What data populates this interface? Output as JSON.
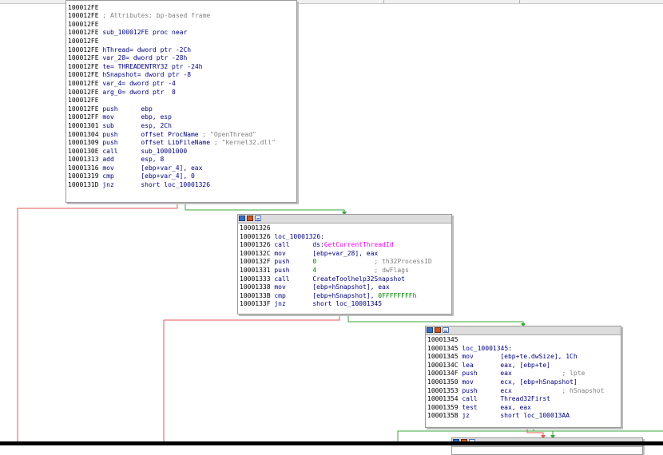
{
  "edge_colors": {
    "false_branch": "#e05a5a",
    "true_branch": "#3aa53a"
  },
  "nodes": [
    {
      "id": "node-10001326-prologue",
      "lines": [
        {
          "addr": "100012FE",
          "text": "",
          "kind": "plain"
        },
        {
          "addr": "100012FE",
          "text": "",
          "kind": "plain"
        },
        {
          "addr": "100012FE",
          "text": " ; Attributes: bp-based frame",
          "kind": "comment"
        },
        {
          "addr": "100012FE",
          "text": "",
          "kind": "plain"
        },
        {
          "addr": "100012FE",
          "text": " sub_100012FE proc near",
          "kind": "label"
        },
        {
          "addr": "100012FE",
          "text": "",
          "kind": "plain"
        },
        {
          "addr": "100012FE",
          "text": " hThread= dword ptr -2Ch",
          "kind": "label"
        },
        {
          "addr": "100012FE",
          "text": " var_28= dword ptr -28h",
          "kind": "label"
        },
        {
          "addr": "100012FE",
          "text": " te= THREADENTRY32 ptr -24h",
          "kind": "label"
        },
        {
          "addr": "100012FE",
          "text": " hSnapshot= dword ptr -8",
          "kind": "label"
        },
        {
          "addr": "100012FE",
          "text": " var_4= dword ptr -4",
          "kind": "label"
        },
        {
          "addr": "100012FE",
          "text": " arg_0= dword ptr  8",
          "kind": "label"
        },
        {
          "addr": "100012FE",
          "text": "",
          "kind": "plain"
        },
        {
          "addr": "100012FE",
          "mnemonic": "push",
          "operand": "ebp",
          "kind": "instr"
        },
        {
          "addr": "100012FF",
          "mnemonic": "mov",
          "operand": "ebp, esp",
          "kind": "instr"
        },
        {
          "addr": "10001301",
          "mnemonic": "sub",
          "operand": "esp, 2Ch",
          "kind": "instr"
        },
        {
          "addr": "10001304",
          "mnemonic": "push",
          "operand": "offset ProcName",
          "comment": " ; \"OpenThread\"",
          "kind": "instr"
        },
        {
          "addr": "10001309",
          "mnemonic": "push",
          "operand": "offset LibFileName",
          "comment": " ; \"kernel32.dll\"",
          "kind": "instr"
        },
        {
          "addr": "1000130E",
          "mnemonic": "call",
          "operand": "sub_10001000",
          "kind": "instr"
        },
        {
          "addr": "10001313",
          "mnemonic": "add",
          "operand": "esp, 8",
          "kind": "instr"
        },
        {
          "addr": "10001316",
          "mnemonic": "mov",
          "operand": "[ebp+var_4], eax",
          "kind": "instr"
        },
        {
          "addr": "10001319",
          "mnemonic": "cmp",
          "operand": "[ebp+var_4], 0",
          "kind": "instr"
        },
        {
          "addr": "1000131D",
          "mnemonic": "jnz",
          "operand": "short loc_10001326",
          "kind": "instr"
        }
      ]
    },
    {
      "id": "node-10001326",
      "lines": [
        {
          "addr": "10001326",
          "text": "",
          "kind": "plain"
        },
        {
          "addr": "10001326",
          "text": " loc_10001326:",
          "kind": "label"
        },
        {
          "addr": "10001326",
          "mnemonic": "call",
          "operand_pre": "ds:",
          "operand_fn": "GetCurrentThreadId",
          "kind": "instr"
        },
        {
          "addr": "1000132C",
          "mnemonic": "mov",
          "operand": "[ebp+var_28], eax",
          "kind": "instr"
        },
        {
          "addr": "1000132F",
          "mnemonic": "push",
          "operand_num": "0",
          "comment": "               ; th32ProcessID",
          "kind": "instr"
        },
        {
          "addr": "10001331",
          "mnemonic": "push",
          "operand_num": "4",
          "comment": "               ; dwFlags",
          "kind": "instr"
        },
        {
          "addr": "10001333",
          "mnemonic": "call",
          "operand": "CreateToolhelp32Snapshot",
          "kind": "instr"
        },
        {
          "addr": "10001338",
          "mnemonic": "mov",
          "operand": "[ebp+hSnapshot], eax",
          "kind": "instr"
        },
        {
          "addr": "1000133B",
          "mnemonic": "cmp",
          "operand": "[ebp+hSnapshot], ",
          "operand_num2": "0FFFFFFFFh",
          "kind": "instr"
        },
        {
          "addr": "1000133F",
          "mnemonic": "jnz",
          "operand": "short loc_10001345",
          "kind": "instr"
        }
      ]
    },
    {
      "id": "node-10001345",
      "lines": [
        {
          "addr": "10001345",
          "text": "",
          "kind": "plain"
        },
        {
          "addr": "10001345",
          "text": " loc_10001345:",
          "kind": "label"
        },
        {
          "addr": "10001345",
          "mnemonic": "mov",
          "operand": "[ebp+te.dwSize], 1Ch",
          "kind": "instr"
        },
        {
          "addr": "1000134C",
          "mnemonic": "lea",
          "operand": "eax, [ebp+te]",
          "kind": "instr"
        },
        {
          "addr": "1000134F",
          "mnemonic": "push",
          "operand": "eax",
          "comment": "             ; lpte",
          "kind": "instr"
        },
        {
          "addr": "10001350",
          "mnemonic": "mov",
          "operand": "ecx, [ebp+hSnapshot]",
          "kind": "instr"
        },
        {
          "addr": "10001353",
          "mnemonic": "push",
          "operand": "ecx",
          "comment": "             ; hSnapshot",
          "kind": "instr"
        },
        {
          "addr": "10001354",
          "mnemonic": "call",
          "operand": "Thread32First",
          "kind": "instr"
        },
        {
          "addr": "10001359",
          "mnemonic": "test",
          "operand": "eax, eax",
          "kind": "instr"
        },
        {
          "addr": "1000135B",
          "mnemonic": "jz",
          "operand": "short loc_100013AA",
          "kind": "instr"
        }
      ]
    }
  ]
}
